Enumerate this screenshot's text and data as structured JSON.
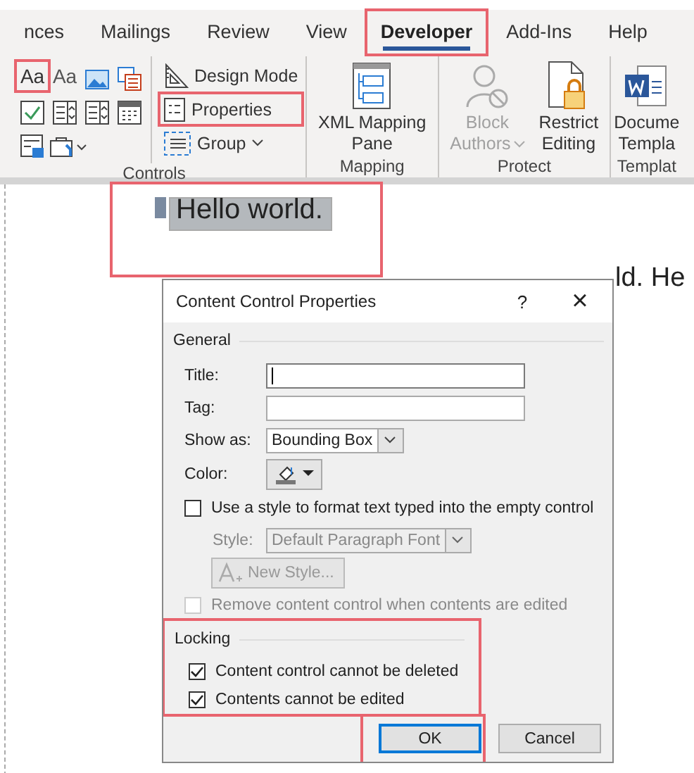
{
  "ribbon": {
    "tabs": [
      {
        "label": "nces",
        "selected": false,
        "highlighted": false
      },
      {
        "label": "Mailings",
        "selected": false,
        "highlighted": false
      },
      {
        "label": "Review",
        "selected": false,
        "highlighted": false
      },
      {
        "label": "View",
        "selected": false,
        "highlighted": false
      },
      {
        "label": "Developer",
        "selected": true,
        "highlighted": true
      },
      {
        "label": "Add-Ins",
        "selected": false,
        "highlighted": false
      },
      {
        "label": "Help",
        "selected": false,
        "highlighted": false
      }
    ],
    "groups": [
      {
        "kind": "controls",
        "label": "Controls",
        "gallery": [
          {
            "kind": "rich-text",
            "glyph": "Aa",
            "highlighted": true
          },
          {
            "kind": "plain-text",
            "glyph": "Aa",
            "highlighted": false
          },
          {
            "kind": "image",
            "highlighted": false
          },
          {
            "kind": "gallery",
            "highlighted": false
          },
          {
            "kind": "checkbox",
            "highlighted": false
          },
          {
            "kind": "combo",
            "highlighted": false
          },
          {
            "kind": "dropdown",
            "highlighted": false
          },
          {
            "kind": "date",
            "highlighted": false
          },
          {
            "kind": "section",
            "highlighted": false
          },
          {
            "kind": "tools",
            "highlighted": false
          }
        ],
        "buttons": [
          {
            "kind": "design",
            "label": "Design Mode",
            "highlighted": false,
            "dropdown": false
          },
          {
            "kind": "properties",
            "label": "Properties",
            "highlighted": true,
            "dropdown": false
          },
          {
            "kind": "group",
            "label": "Group",
            "highlighted": false,
            "dropdown": true
          }
        ]
      },
      {
        "kind": "large",
        "label": "Mapping",
        "buttons": [
          {
            "kind": "xml",
            "lines": [
              "XML Mapping",
              "Pane"
            ],
            "disabled": false,
            "dropdown": false
          }
        ]
      },
      {
        "kind": "large",
        "label": "Protect",
        "buttons": [
          {
            "kind": "block",
            "lines": [
              "Block",
              "Authors"
            ],
            "disabled": true,
            "dropdown": true
          },
          {
            "kind": "restrict",
            "lines": [
              "Restrict",
              "Editing"
            ],
            "disabled": false,
            "dropdown": false
          }
        ]
      },
      {
        "kind": "large",
        "label": "Templat",
        "buttons": [
          {
            "kind": "template",
            "lines": [
              "Docume",
              "Templa"
            ],
            "disabled": false,
            "dropdown": false
          }
        ]
      }
    ]
  },
  "document": {
    "content_control": {
      "text": "Hello world.",
      "selected": true,
      "highlighted": true
    },
    "paragraph": "ld. He"
  },
  "dialog": {
    "title": "Content Control Properties",
    "help": "?",
    "close": "×",
    "general": {
      "heading": "General",
      "fields": [
        {
          "kind": "text",
          "label": "Title:",
          "focused": true
        },
        {
          "kind": "text",
          "label": "Tag:",
          "focused": false
        },
        {
          "kind": "select",
          "label": "Show as:",
          "value": "Bounding Box"
        },
        {
          "kind": "color",
          "label": "Color:"
        }
      ],
      "use_style": {
        "label": "Use a style to format text typed into the empty control",
        "checked": false
      },
      "style": {
        "label": "Style:",
        "value": "Default Paragraph Font",
        "disabled": true
      },
      "new_style": {
        "label": "New Style...",
        "disabled": true
      },
      "remove": {
        "label": "Remove content control when contents are edited",
        "checked": false,
        "disabled": true
      }
    },
    "locking": {
      "heading": "Locking",
      "highlighted": true,
      "options": [
        {
          "label": "Content control cannot be deleted",
          "checked": true
        },
        {
          "label": "Contents cannot be edited",
          "checked": true
        }
      ]
    },
    "buttons": [
      {
        "label": "OK",
        "default": true,
        "highlighted": true
      },
      {
        "label": "Cancel",
        "default": false,
        "highlighted": false
      }
    ]
  }
}
